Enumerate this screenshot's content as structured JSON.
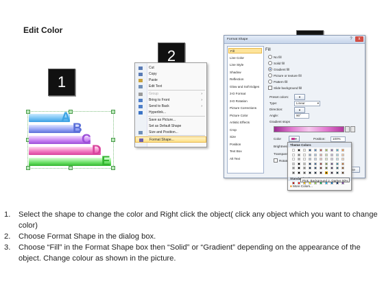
{
  "title": "Edit Color",
  "step_badges": [
    "1",
    "2",
    "3"
  ],
  "bars": {
    "letters": [
      "A",
      "B",
      "C",
      "D",
      "E"
    ],
    "letter_colors": [
      "#3ea4e4",
      "#5b6fd8",
      "#9c4fd8",
      "#d8449d",
      "#34b630"
    ]
  },
  "context_menu": {
    "items": [
      {
        "label": "Cut",
        "icon": "scissors-icon",
        "disabled": false
      },
      {
        "label": "Copy",
        "icon": "copy-icon",
        "disabled": false
      },
      {
        "label": "Paste",
        "icon": "paste-icon",
        "disabled": false
      },
      {
        "label": "Edit Text",
        "icon": "edit-text-icon",
        "disabled": false
      },
      {
        "label": "Group",
        "icon": "group-icon",
        "disabled": true,
        "arrow": "›"
      },
      {
        "label": "Bring to Front",
        "icon": "bring-front-icon",
        "disabled": false,
        "arrow": "›"
      },
      {
        "label": "Send to Back",
        "icon": "send-back-icon",
        "disabled": false,
        "arrow": "›"
      },
      {
        "label": "Hyperlink...",
        "icon": "hyperlink-icon",
        "disabled": false
      },
      {
        "label": "Save as Picture...",
        "icon": "",
        "disabled": false
      },
      {
        "label": "Set as Default Shape",
        "icon": "",
        "disabled": false
      },
      {
        "label": "Size and Position...",
        "icon": "size-icon",
        "disabled": false
      },
      {
        "label": "Format Shape...",
        "icon": "format-shape-icon",
        "disabled": false,
        "highlighted": true
      }
    ]
  },
  "dialog": {
    "title": "Format Shape",
    "help": "?",
    "close": "x",
    "nav": [
      "Fill",
      "Line Color",
      "Line Style",
      "Shadow",
      "Reflection",
      "Glow and Soft Edges",
      "3-D Format",
      "3-D Rotation",
      "Picture Corrections",
      "Picture Color",
      "Artistic Effects",
      "Crop",
      "Size",
      "Position",
      "Text Box",
      "Alt Text"
    ],
    "section": "Fill",
    "fill_options": [
      "No fill",
      "Solid fill",
      "Gradient fill",
      "Picture or texture fill",
      "Pattern fill",
      "Slide background fill"
    ],
    "selected_fill": 2,
    "preset_label": "Preset colors:",
    "type_label": "Type:",
    "type_value": "Linear",
    "direction_label": "Direction:",
    "angle_label": "Angle:",
    "angle_value": "90°",
    "gradient_stops_label": "Gradient stops",
    "color_label": "Color",
    "position_label": "Position:",
    "position_value": "100%",
    "brightness_label": "Brightness:",
    "transparency_label": "Transparency:",
    "rotate_label": "Rotate with shape",
    "close_button": "Close"
  },
  "color_picker": {
    "theme_header": "Theme Colors",
    "standard_header": "Standard Colors",
    "more_colors": "More Colors...",
    "tooltip": "Pink, Background 2, Darker 50%",
    "theme_row": [
      "#ffffff",
      "#000000",
      "#eeece1",
      "#1f497d",
      "#4f81bd",
      "#c0504d",
      "#9bbb59",
      "#8064a2",
      "#4bacc6",
      "#f79646"
    ],
    "standard_row": [
      "#c00000",
      "#ff0000",
      "#ffc000",
      "#ffff00",
      "#92d050",
      "#00b050",
      "#00b0f0",
      "#0070c0",
      "#002060",
      "#7030a0"
    ]
  },
  "steps": [
    {
      "n": "1.",
      "text": "Select the shape to change the color and Right click the object( click any object which you want to change color)"
    },
    {
      "n": "2.",
      "text": "Choose Format Shape in the dialog box."
    },
    {
      "n": "3.",
      "text": "Choose “Fill” in the Format Shape box then “Solid” or “Gradient” depending on the appearance of the object. Change colour as shown in the picture."
    }
  ]
}
